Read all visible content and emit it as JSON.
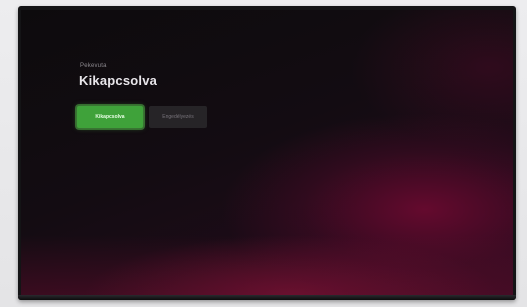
{
  "screen": {
    "breadcrumb": "Pekevuta",
    "title": "Kikapcsolva",
    "buttons": [
      {
        "label": "Kikapcsolva",
        "state": "focused"
      },
      {
        "label": "Engedélyezés",
        "state": "normal"
      }
    ]
  },
  "colors": {
    "focus_green": "#3fa23a",
    "screen_glow": "#82103a",
    "title_text": "#e8e6ea"
  }
}
